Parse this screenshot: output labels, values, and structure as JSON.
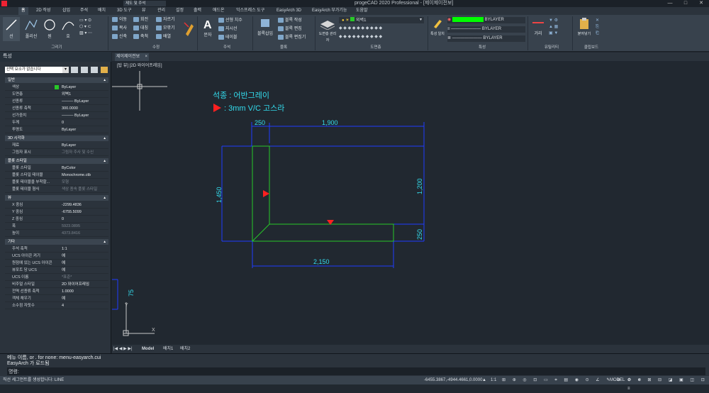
{
  "app": {
    "title": "progeCAD 2020 Professional - [제이제이전보]",
    "quick_search": "제도 및 주석"
  },
  "menu": [
    "홈",
    "2D 작성",
    "삽입",
    "주석",
    "배치",
    "3D 도구",
    "뷰",
    "관리",
    "설정",
    "출력",
    "애드온",
    "익스프레스 도구",
    "EasyArch 3D",
    "EasyArch 부가기능",
    "도움말"
  ],
  "ribbon": {
    "draw": {
      "label": "그리기",
      "items": [
        "선",
        "폴리선",
        "원",
        "호"
      ]
    },
    "modify": {
      "label": "수정",
      "items": [
        "이동",
        "회전",
        "자르기",
        "복사",
        "대칭",
        "모깎기",
        "신축",
        "축척",
        "배열"
      ]
    },
    "text": {
      "label": "주석",
      "items": [
        "문자",
        "선형 치수",
        "지시선",
        "테이블"
      ]
    },
    "block": {
      "label": "블록",
      "items": [
        "블록삽입",
        "블록 작성",
        "블록 편집",
        "블록 편집기"
      ]
    },
    "layers": {
      "label": "도면층",
      "manager": "도면층 관리자",
      "current": "외벽1"
    },
    "props": {
      "label": "특성",
      "match": "특성 일치",
      "color": "BYLAYER",
      "linetype": "BYLAYER",
      "lineweight": "BYLAYER"
    },
    "utilities": {
      "label": "유틸리티",
      "measure": "거리"
    },
    "clipboard": {
      "label": "클립보드",
      "paste": "붙여넣기"
    }
  },
  "panel": {
    "title": "특성",
    "selection": "선택 요소가 없습니다",
    "sections": [
      {
        "name": "일반",
        "rows": [
          [
            "색상",
            "ByLayer"
          ],
          [
            "도면층",
            "외벽1"
          ],
          [
            "선종류",
            "——— ByLayer"
          ],
          [
            "선종류 축척",
            "300.0000"
          ],
          [
            "선가중치",
            "——— ByLayer"
          ],
          [
            "두께",
            "0"
          ],
          [
            "투명도",
            "ByLayer"
          ]
        ]
      },
      {
        "name": "3D 시각화",
        "rows": [
          [
            "재료",
            "ByLayer"
          ],
          [
            "그림자 표시",
            "그림자 주사 및 수신"
          ]
        ]
      },
      {
        "name": "플롯 스타일",
        "rows": [
          [
            "플롯 스타일",
            "ByColor"
          ],
          [
            "플롯 스타일 테이블",
            "Monochrome.ctb"
          ],
          [
            "플롯 테이블을 부착할...",
            "모형"
          ],
          [
            "플롯 테이블 형식",
            "색상 종속 플롯 스타일"
          ]
        ]
      },
      {
        "name": "뷰",
        "rows": [
          [
            "X 중심",
            "-2299.4836"
          ],
          [
            "Y 중심",
            "-6755.5099"
          ],
          [
            "Z 중심",
            "0"
          ],
          [
            "폭",
            "5923.0895"
          ],
          [
            "높이",
            "4373.8416"
          ]
        ]
      },
      {
        "name": "기타",
        "rows": [
          [
            "주석 축척",
            "1:1"
          ],
          [
            "UCS 아이콘 켜기",
            "예"
          ],
          [
            "원점에 있는 UCS 아이콘",
            "예"
          ],
          [
            "뷰포트 당 UCS",
            "예"
          ],
          [
            "UCS 이름",
            "*표준*"
          ],
          [
            "비주얼 스타일",
            "2D 와이어프레임"
          ],
          [
            "전역 선종류 축척",
            "1.0000"
          ],
          [
            "객체 채우기",
            "예"
          ],
          [
            "소수점 자릿수",
            "4"
          ]
        ]
      }
    ]
  },
  "doc_tab": "제이제이전보",
  "viewport_label": "[탑 뷰] [2D 와이어프레임]",
  "drawing": {
    "note1": "석종 :  어반그레이",
    "note2": ": 3mm V/C 고스라",
    "dims": {
      "top_left": "250",
      "top": "1,900",
      "left": "1,450",
      "right": "1,200",
      "right_small": "250",
      "bottom": "2,150",
      "side_small": "75"
    }
  },
  "layout_tabs": [
    "Model",
    "배치1",
    "배치2"
  ],
  "command": {
    "line1": "메뉴 이름, or . for none: menu-easyarch.cui",
    "line2": "EasyArch 가 로드됨",
    "prompt": "명령:"
  },
  "status": {
    "left": "직선 세그먼트를 생성합니다: LINE",
    "coords": "-6455.3867,-4944.4661,0.0000",
    "scale": "1:1",
    "model": "MODEL"
  },
  "colors": {
    "accent": "#ff2020",
    "line_green": "#28c828",
    "dim_blue": "#1f3cff",
    "text_cyan": "#33ddee"
  }
}
